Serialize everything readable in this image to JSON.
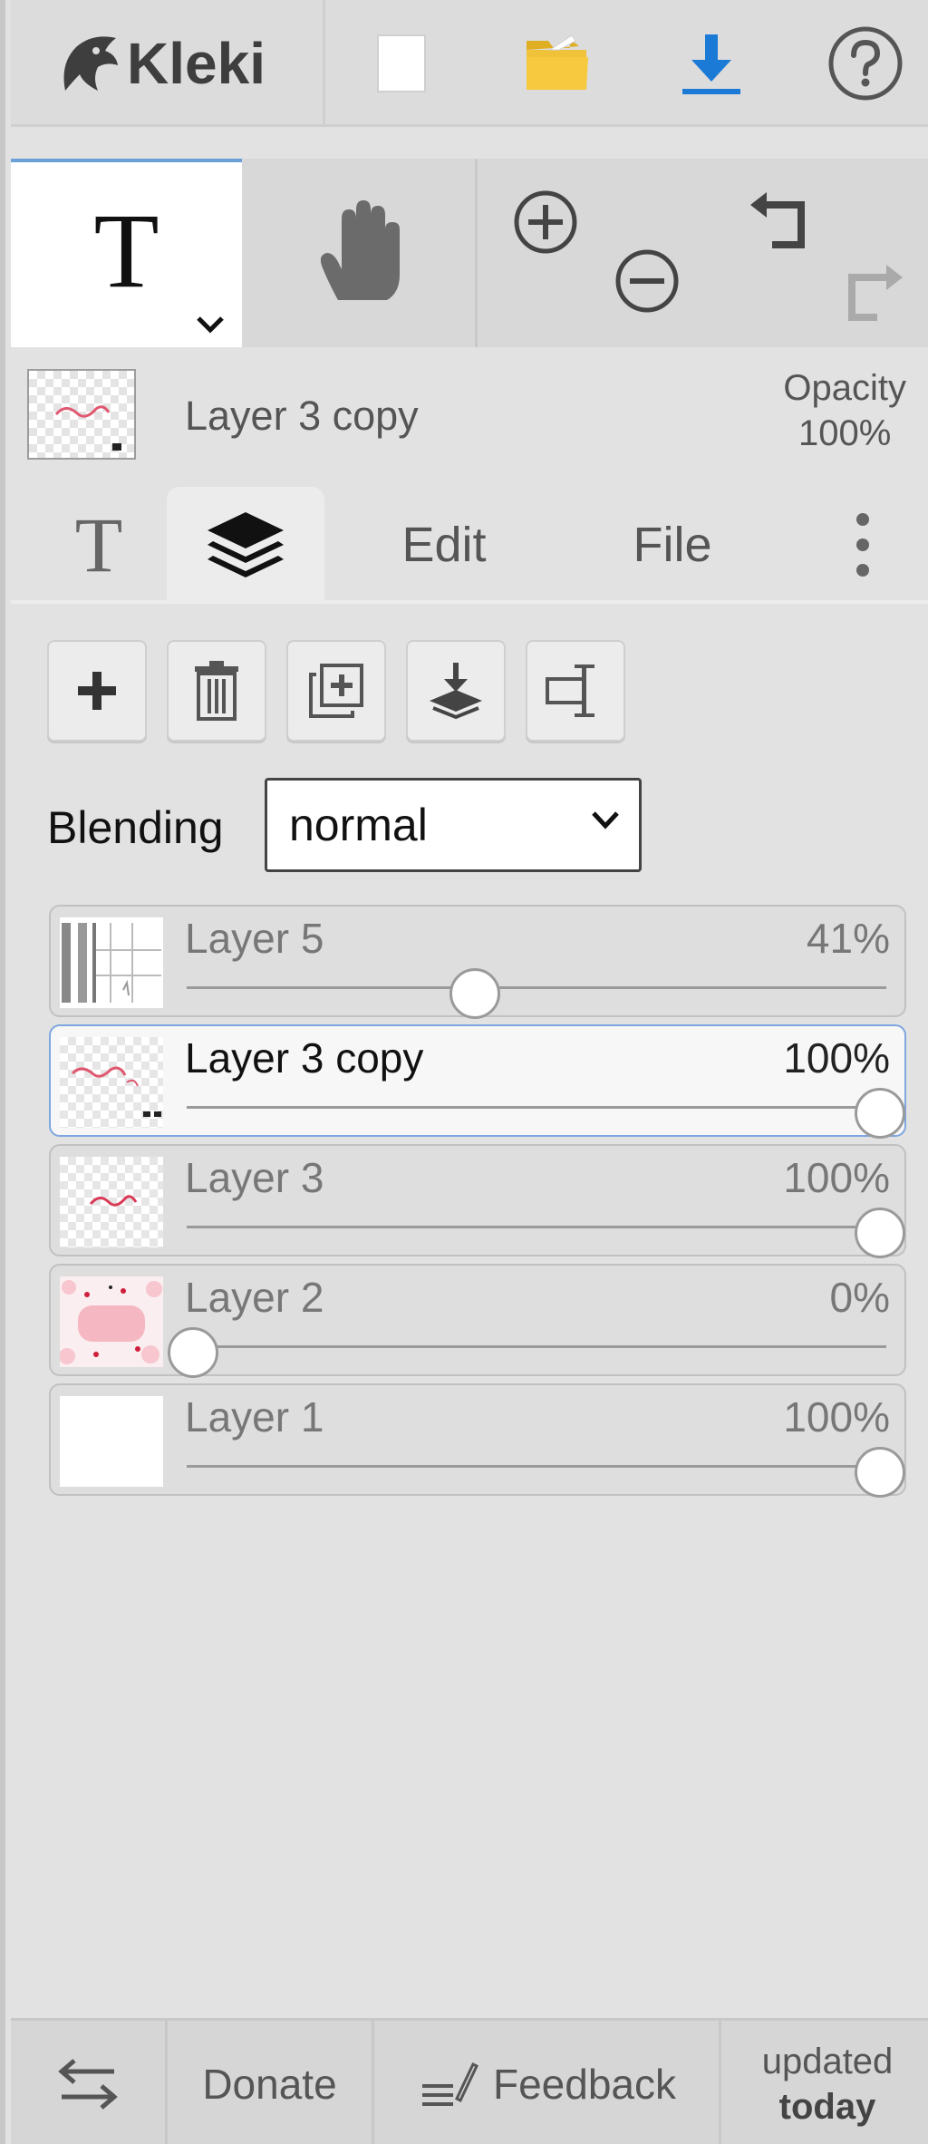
{
  "app": {
    "logo_text": "Kleki"
  },
  "header": {
    "icons": [
      "new-image-icon",
      "open-folder-icon",
      "download-icon",
      "help-icon"
    ],
    "colors": {
      "folder": "#f0c23a",
      "download": "#1a7ad6"
    }
  },
  "tools": {
    "active": "text",
    "text_tool_glyph": "T",
    "items": [
      "text-tool",
      "hand-tool",
      "zoom-in",
      "zoom-out",
      "undo",
      "redo"
    ]
  },
  "layer_info": {
    "name": "Layer 3 copy",
    "opacity_label": "Opacity",
    "opacity_value": "100%"
  },
  "tabs": {
    "text_glyph": "T",
    "edit": "Edit",
    "file": "File",
    "active": "layers"
  },
  "layer_actions": [
    "add-layer",
    "delete-layer",
    "duplicate-layer",
    "merge-down",
    "rename-layer"
  ],
  "blending": {
    "label": "Blending",
    "value": "normal"
  },
  "layers": [
    {
      "name": "Layer 5",
      "opacity": "41%",
      "value": 0.41,
      "selected": false
    },
    {
      "name": "Layer 3 copy",
      "opacity": "100%",
      "value": 1.0,
      "selected": true
    },
    {
      "name": "Layer 3",
      "opacity": "100%",
      "value": 1.0,
      "selected": false
    },
    {
      "name": "Layer 2",
      "opacity": "0%",
      "value": 0.0,
      "selected": false
    },
    {
      "name": "Layer 1",
      "opacity": "100%",
      "value": 1.0,
      "selected": false
    }
  ],
  "footer": {
    "donate": "Donate",
    "feedback": "Feedback",
    "updated_line1": "updated",
    "updated_line2": "today"
  }
}
